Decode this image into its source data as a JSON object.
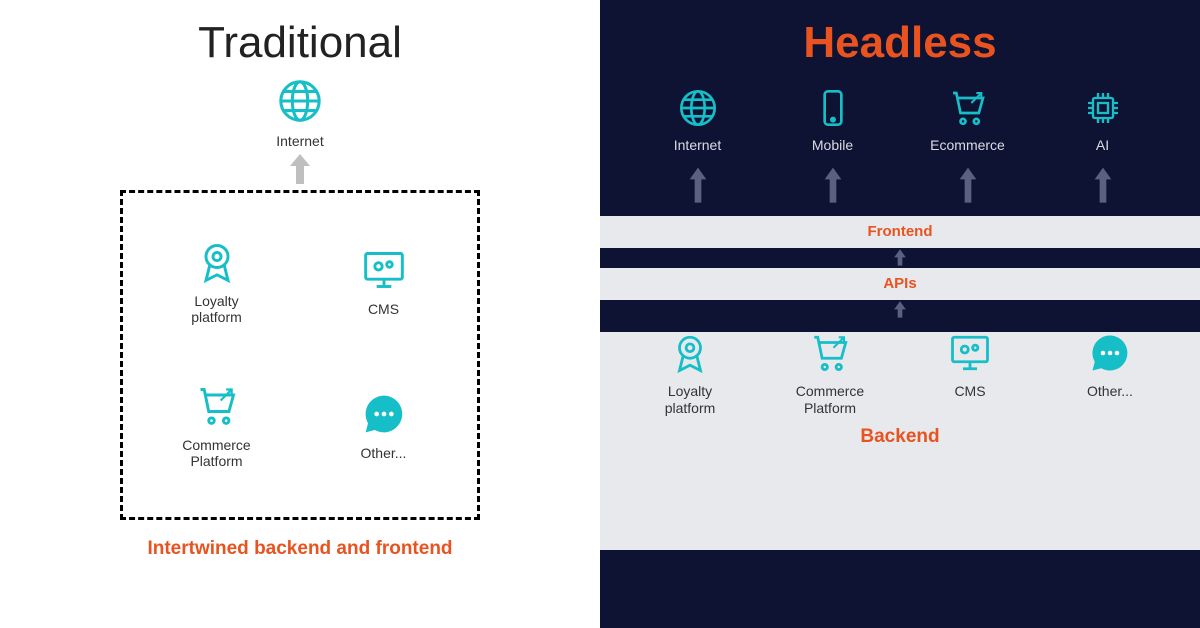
{
  "left": {
    "title": "Traditional",
    "internet_label": "Internet",
    "box": {
      "loyalty": "Loyalty platform",
      "cms": "CMS",
      "commerce": "Commerce Platform",
      "other": "Other..."
    },
    "footer": "Intertwined backend and frontend"
  },
  "right": {
    "title": "Headless",
    "channels": {
      "internet": "Internet",
      "mobile": "Mobile",
      "ecommerce": "Ecommerce",
      "ai": "AI"
    },
    "frontend_label": "Frontend",
    "apis_label": "APIs",
    "backend": {
      "loyalty": "Loyalty platform",
      "commerce": "Commerce Platform",
      "cms": "CMS",
      "other": "Other..."
    },
    "backend_label": "Backend"
  }
}
